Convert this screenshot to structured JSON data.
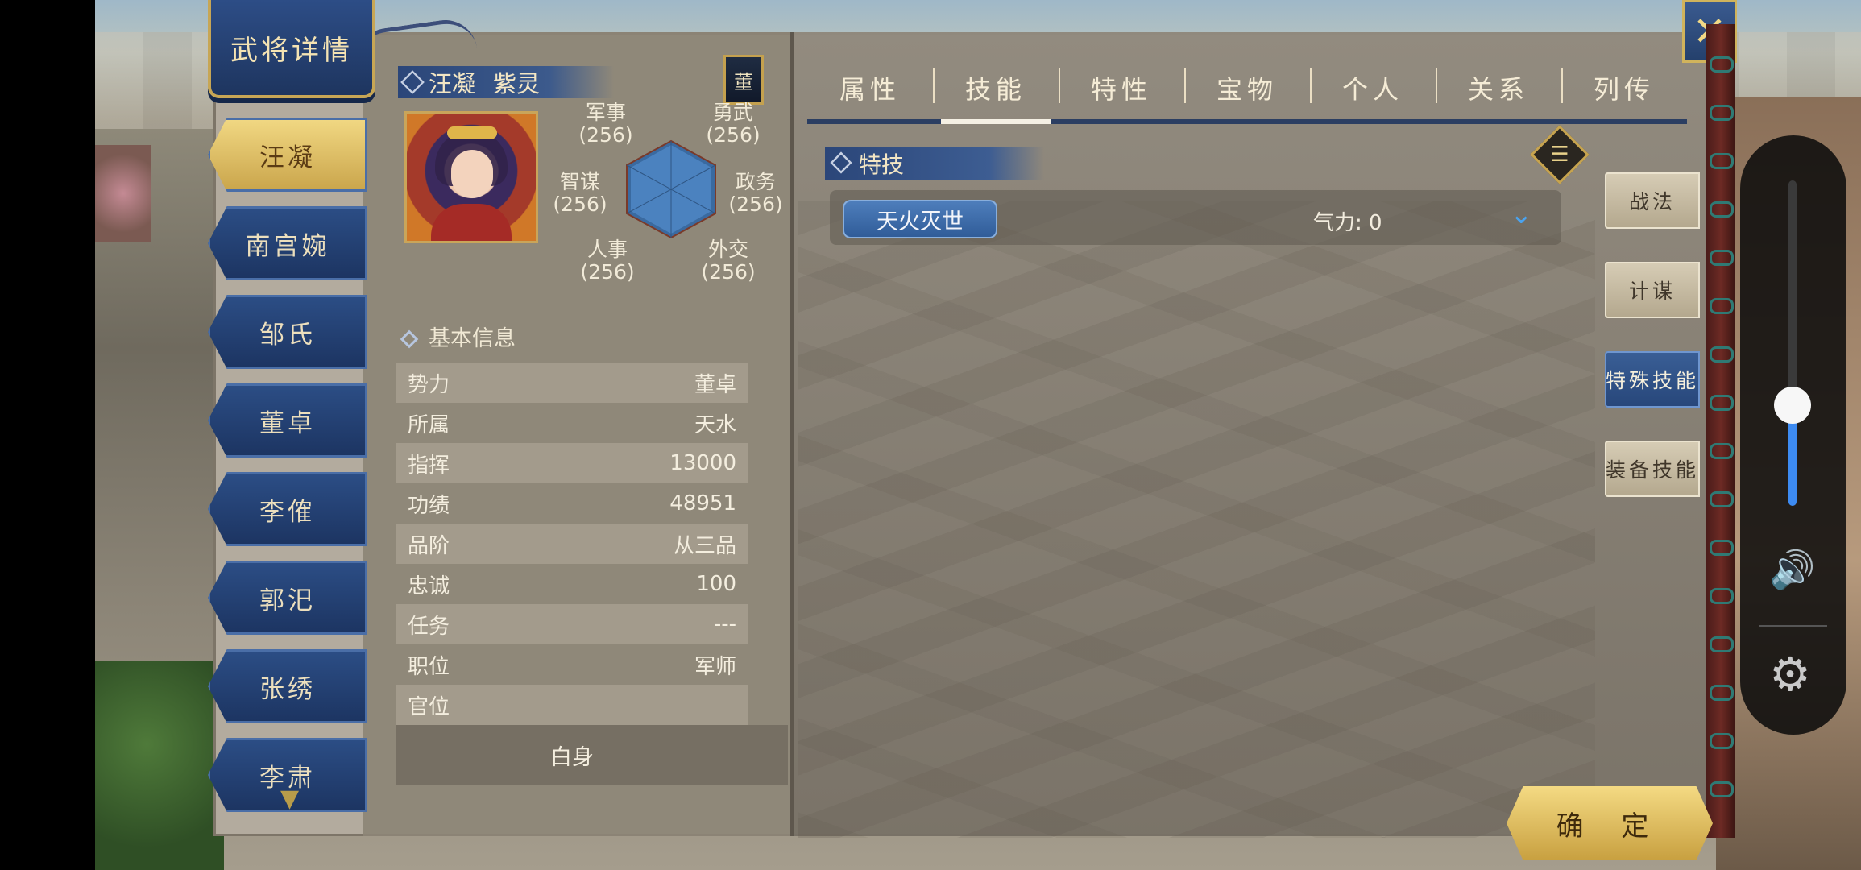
{
  "title": "武将详情",
  "close_icon": "close-icon",
  "characters": [
    "汪凝",
    "南宫婉",
    "邹氏",
    "董卓",
    "李傕",
    "郭汜",
    "张绣",
    "李肃"
  ],
  "active_character_index": 0,
  "general": {
    "name": "汪凝",
    "style_name": "紫灵",
    "faction_tag": "董"
  },
  "stats": [
    {
      "label": "军事",
      "value": "(256)"
    },
    {
      "label": "勇武",
      "value": "(256)"
    },
    {
      "label": "智谋",
      "value": "(256)"
    },
    {
      "label": "政务",
      "value": "(256)"
    },
    {
      "label": "人事",
      "value": "(256)"
    },
    {
      "label": "外交",
      "value": "(256)"
    }
  ],
  "basic_info": {
    "header": "基本信息",
    "rows": [
      {
        "label": "势力",
        "value": "董卓"
      },
      {
        "label": "所属",
        "value": "天水"
      },
      {
        "label": "指挥",
        "value": "13000"
      },
      {
        "label": "功绩",
        "value": "48951"
      },
      {
        "label": "品阶",
        "value": "从三品"
      },
      {
        "label": "忠诚",
        "value": "100"
      },
      {
        "label": "任务",
        "value": "---"
      },
      {
        "label": "职位",
        "value": "军师"
      },
      {
        "label": "官位",
        "value": ""
      }
    ],
    "status": "白身"
  },
  "tabs": [
    "属性",
    "技能",
    "特性",
    "宝物",
    "个人",
    "关系",
    "列传"
  ],
  "active_tab_index": 1,
  "skills": {
    "header": "特技",
    "items": [
      {
        "name": "天火灭世",
        "power": "气力: 0"
      }
    ]
  },
  "side_tabs": [
    "战法",
    "计谋",
    "特殊技能",
    "装备技能"
  ],
  "active_side_tab_index": 2,
  "confirm_label": "确 定",
  "volume": {
    "level": 0.31,
    "speaker_icon": "speaker-icon",
    "settings_icon": "gear-icon"
  },
  "colors": {
    "banner_blue": "#2d4d86",
    "gold": "#c9a44a",
    "accent_blue": "#3d8bf2"
  }
}
